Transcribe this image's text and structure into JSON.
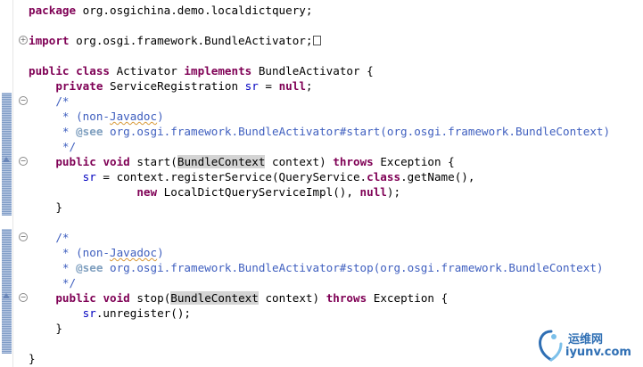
{
  "code": {
    "package_kw": "package",
    "package_name": " org.osgichina.demo.localdictquery;",
    "import_kw": "import",
    "import_name": " org.osgi.framework.BundleActivator;",
    "class_public": "public",
    "class_class": "class",
    "class_name": " Activator ",
    "class_implements": "implements",
    "class_iface": " BundleActivator {",
    "field_private": "private",
    "field_type": " ServiceRegistration ",
    "field_name": "sr",
    "field_eq": " = ",
    "field_null": "null",
    "field_end": ";",
    "c1_open": "/*",
    "c1_prefix": " * (non-",
    "c1_javadoc": "Javadoc",
    "c1_close_paren": ")",
    "c1_see_star": " * ",
    "c1_see_tag": "@see",
    "c1_see_ref": " org.osgi.framework.BundleActivator#start(org.osgi.framework.BundleContext)",
    "c1_end": " */",
    "start_public": "public",
    "start_void": "void",
    "start_name": " start(",
    "start_param_type": "BundleContext",
    "start_param": " context) ",
    "start_throws": "throws",
    "start_exc": " Exception {",
    "reg_sr": "sr",
    "reg_mid": " = context.registerService(QueryService.",
    "reg_class": "class",
    "reg_end": ".getName(),",
    "new_kw": "new",
    "new_rest": " LocalDictQueryServiceImpl(), ",
    "new_null": "null",
    "new_end": ");",
    "start_close": "}",
    "c2_open": "/*",
    "c2_prefix": " * (non-",
    "c2_javadoc": "Javadoc",
    "c2_close_paren": ")",
    "c2_see_star": " * ",
    "c2_see_tag": "@see",
    "c2_see_ref": " org.osgi.framework.BundleActivator#stop(org.osgi.framework.BundleContext)",
    "c2_end": " */",
    "stop_public": "public",
    "stop_void": "void",
    "stop_name": " stop(",
    "stop_param_type": "BundleContext",
    "stop_param": " context) ",
    "stop_throws": "throws",
    "stop_exc": " Exception {",
    "unreg_sr": "sr",
    "unreg_rest": ".unregister();",
    "stop_close": "}",
    "class_close": "}"
  },
  "fold_markers": {
    "expand": "+",
    "collapse": "−"
  },
  "watermark": {
    "chinese": "运维网",
    "url": "iyunv.com"
  },
  "colors": {
    "keyword": "#7f0055",
    "field": "#0000c0",
    "comment": "#3f5fbf",
    "javadoc_tag": "#7f9fbf"
  }
}
